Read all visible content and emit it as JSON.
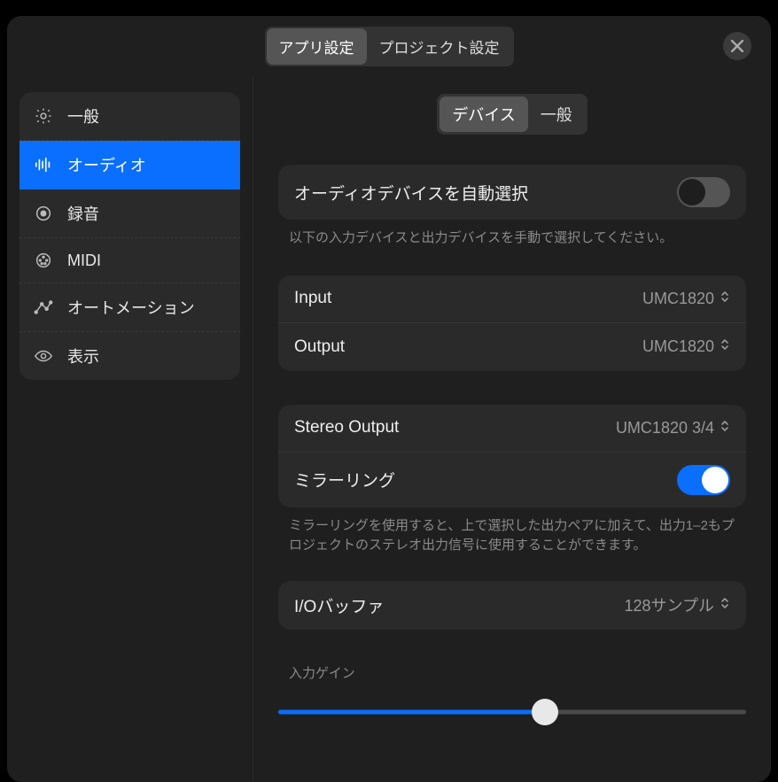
{
  "header": {
    "tab_app": "アプリ設定",
    "tab_project": "プロジェクト設定"
  },
  "sidebar": {
    "items": [
      {
        "label": "一般"
      },
      {
        "label": "オーディオ"
      },
      {
        "label": "録音"
      },
      {
        "label": "MIDI"
      },
      {
        "label": "オートメーション"
      },
      {
        "label": "表示"
      }
    ]
  },
  "content": {
    "sub_tabs": {
      "device": "デバイス",
      "general": "一般"
    },
    "auto_select": {
      "label": "オーディオデバイスを自動選択",
      "help": "以下の入力デバイスと出力デバイスを手動で選択してください。",
      "value": false
    },
    "io": {
      "input_label": "Input",
      "input_value": "UMC1820",
      "output_label": "Output",
      "output_value": "UMC1820"
    },
    "stereo": {
      "label": "Stereo Output",
      "value": "UMC1820 3/4"
    },
    "mirroring": {
      "label": "ミラーリング",
      "value": true,
      "help": "ミラーリングを使用すると、上で選択した出力ペアに加えて、出力1–2もプロジェクトのステレオ出力信号に使用することができます。"
    },
    "buffer": {
      "label": "I/Oバッファ",
      "value": "128サンプル"
    },
    "gain": {
      "label": "入力ゲイン",
      "percent": 57
    }
  }
}
